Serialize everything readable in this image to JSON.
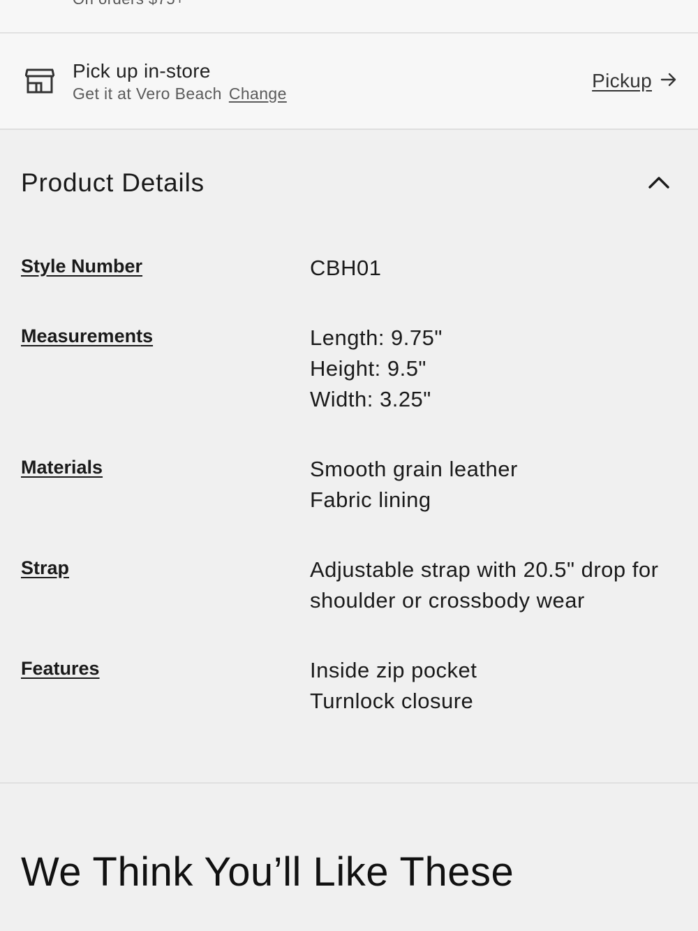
{
  "top_strip": {
    "cut_text": "On orders $75+"
  },
  "pickup": {
    "title": "Pick up in-store",
    "subtitle": "Get it at Vero Beach",
    "change_label": "Change",
    "link_label": "Pickup",
    "icon": "store-icon"
  },
  "product_details": {
    "title": "Product Details",
    "toggle_icon": "chevron-up-icon",
    "specs": {
      "style_number": {
        "label": "Style Number",
        "lines": [
          "CBH01"
        ]
      },
      "measurements": {
        "label": "Measurements",
        "lines": [
          "Length: 9.75\"",
          "Height: 9.5\"",
          "Width: 3.25\""
        ]
      },
      "materials": {
        "label": "Materials",
        "lines": [
          "Smooth grain leather",
          "Fabric lining"
        ]
      },
      "strap": {
        "label": "Strap",
        "lines": [
          "Adjustable strap with 20.5\" drop for",
          "shoulder or crossbody wear"
        ]
      },
      "features": {
        "label": "Features",
        "lines": [
          "Inside zip pocket",
          "Turnlock closure"
        ]
      }
    }
  },
  "recommendations": {
    "title": "We Think You’ll Like These"
  }
}
